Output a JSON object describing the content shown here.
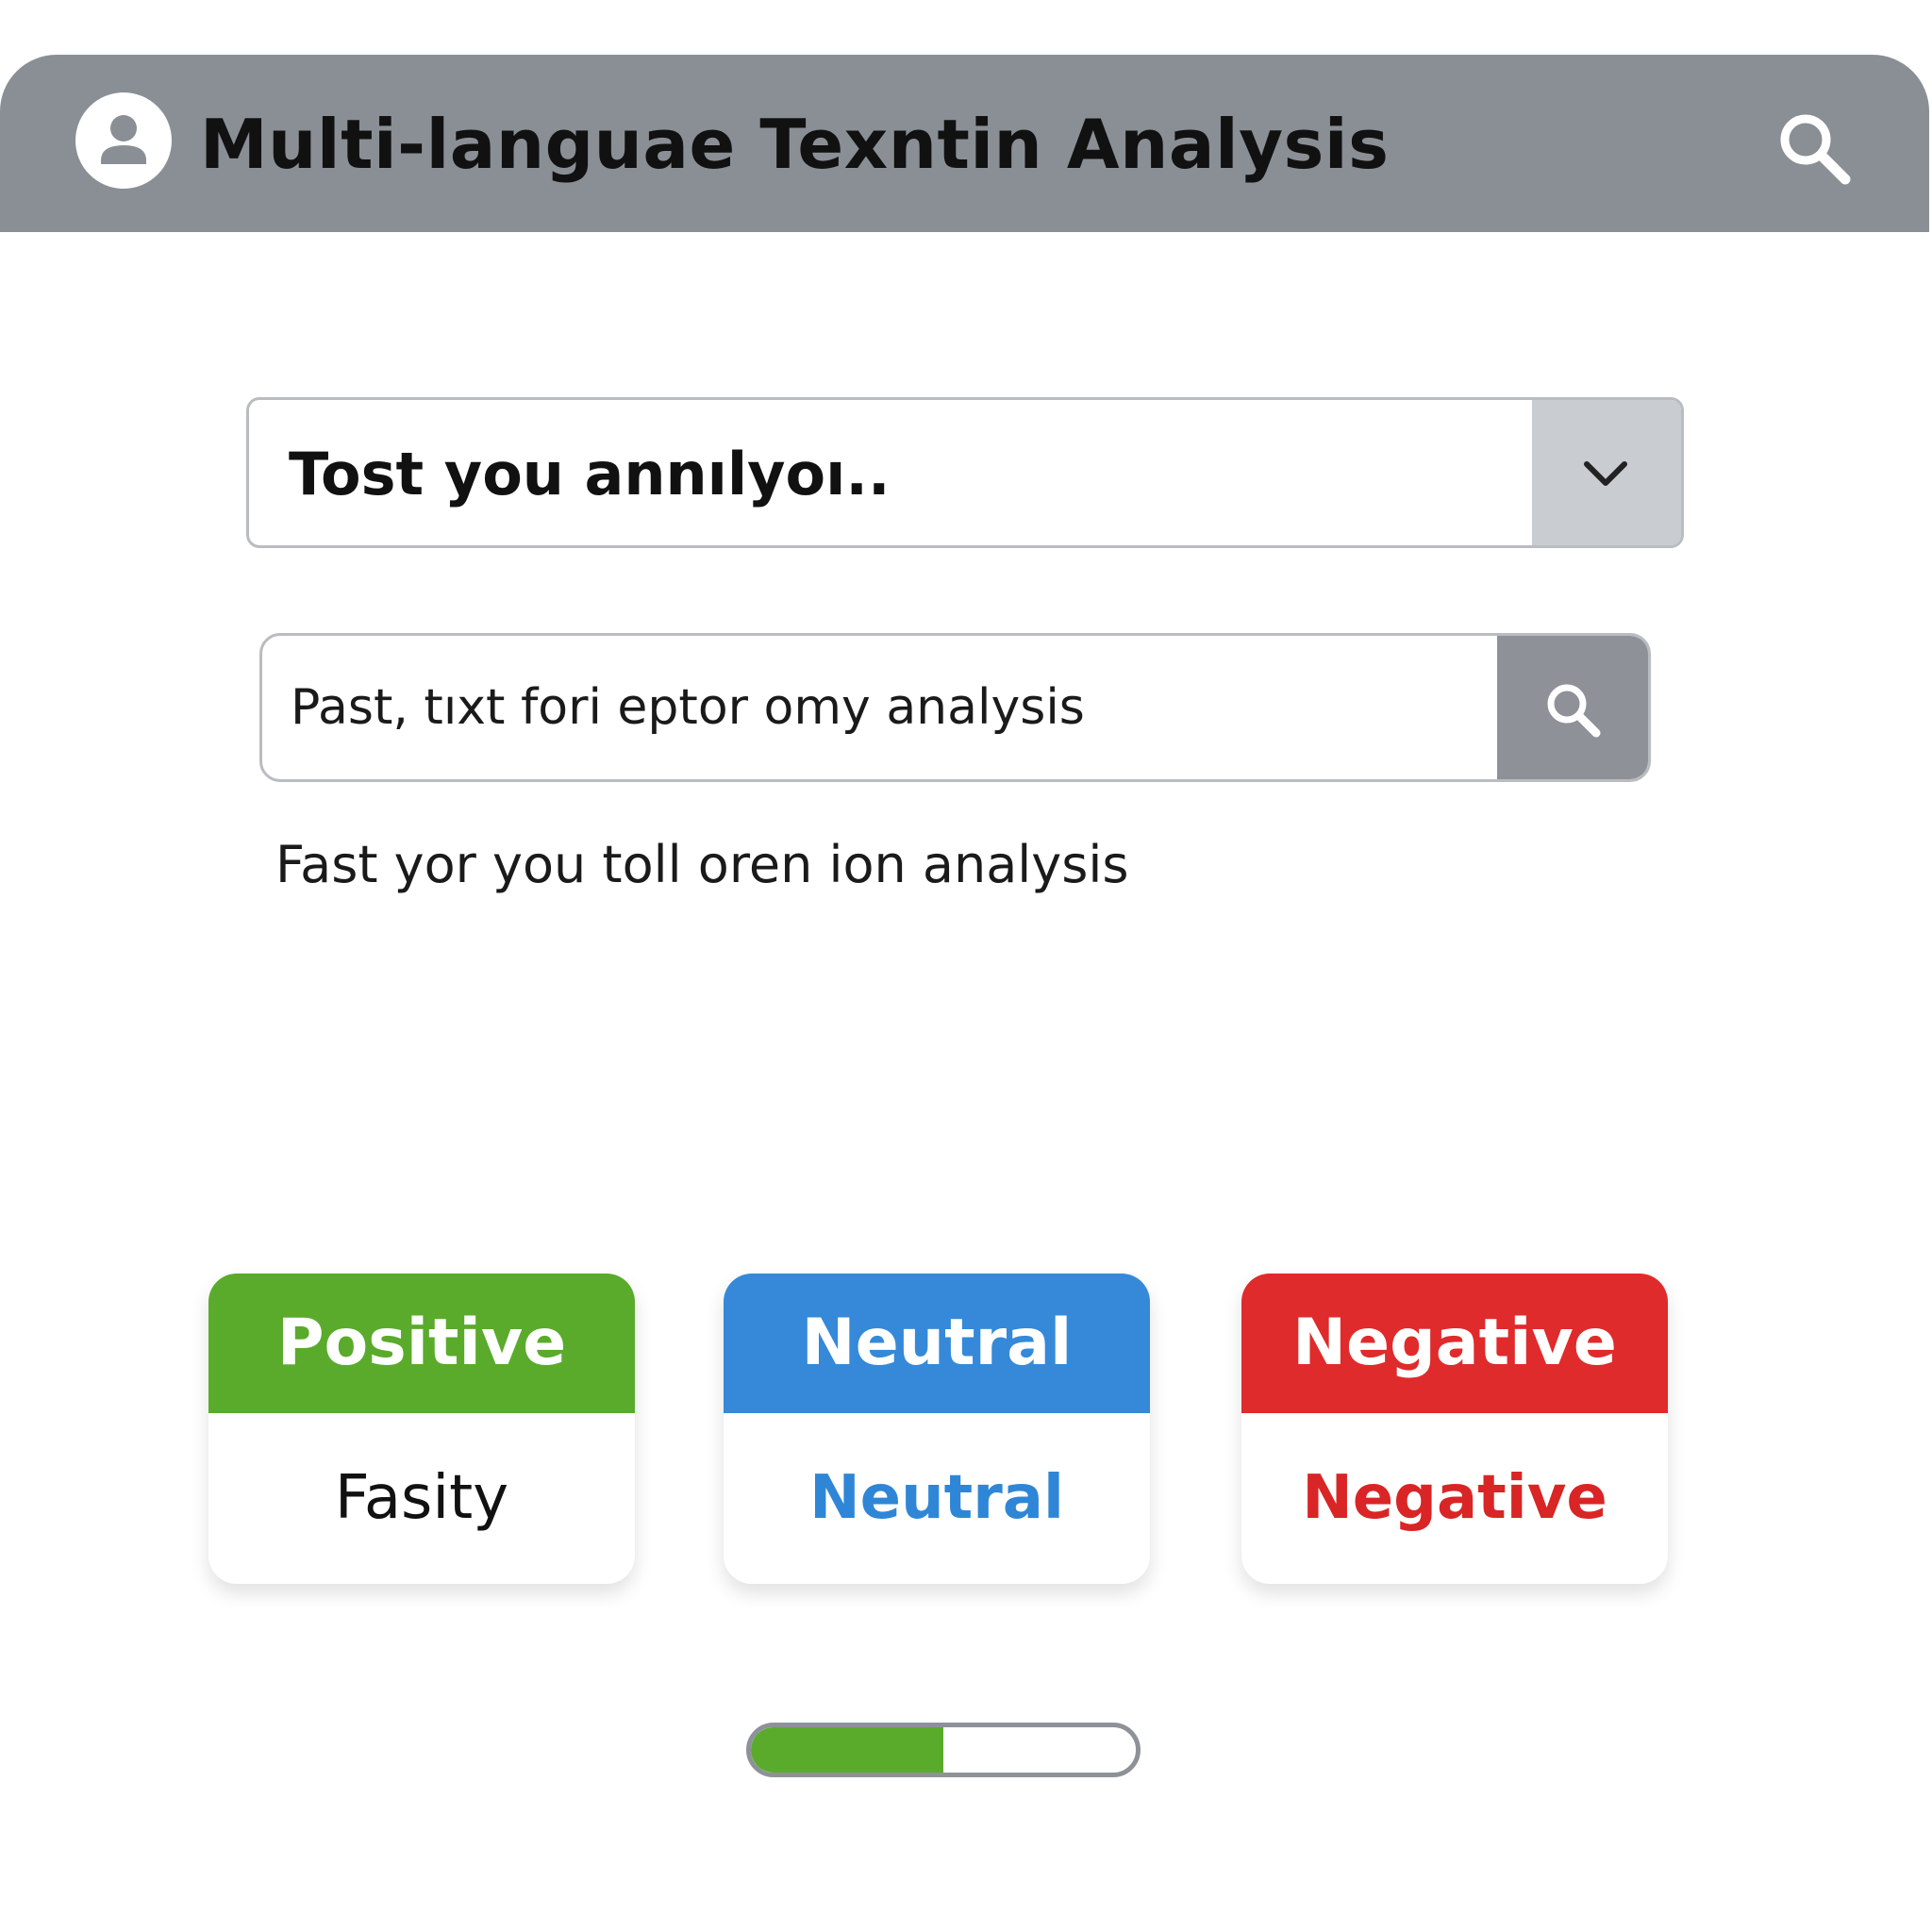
{
  "header": {
    "title": "Multi-languae Texntin Analysis",
    "avatar_icon": "user-icon",
    "search_icon": "search-icon"
  },
  "select": {
    "value": "Tost you annılyoı..",
    "toggle_icon": "chevron-down-icon"
  },
  "text_input": {
    "placeholder": "Past, tıxt fori eptor omy analysis",
    "button_icon": "search-icon"
  },
  "helper_text": "Fast yor you toll oren ion analysis",
  "cards": [
    {
      "label": "Positive",
      "value": "Fasity",
      "color": "#5aab2b"
    },
    {
      "label": "Neutral",
      "value": "Neutral",
      "color": "#3589d8"
    },
    {
      "label": "Negative",
      "value": "Negative",
      "color": "#df2b2b"
    }
  ],
  "progress": {
    "value": 0.5,
    "color": "#5aab2b"
  },
  "colors": {
    "header_bg": "#8a8f95",
    "toggle_bg": "#c9ccd0",
    "search_button_bg": "#8e9298"
  }
}
